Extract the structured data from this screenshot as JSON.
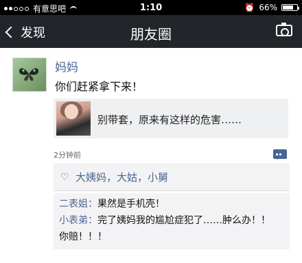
{
  "status_bar": {
    "carrier": "有意思吧",
    "time": "1:10",
    "battery": "66%",
    "battery_level": 0.66
  },
  "nav": {
    "back_label": "发现",
    "title": "朋友圈"
  },
  "post": {
    "author": "妈妈",
    "text": "你们赶紧拿下来！",
    "link_title": "别带套，原来有这样的危害……",
    "timestamp": "2分钟前",
    "likes": "大姨妈，大姑，小舅"
  },
  "comments": [
    {
      "name": "二表姐：",
      "text": "果然是手机壳！"
    },
    {
      "name": "小表弟：",
      "text": "完了姨妈我的尴尬症犯了……肿么办！！"
    },
    {
      "name": "",
      "text": "你赔！！！"
    }
  ],
  "icons": {
    "back": "chevron-left-icon",
    "camera": "camera-icon",
    "comment": "comment-icon",
    "like": "heart-icon"
  }
}
